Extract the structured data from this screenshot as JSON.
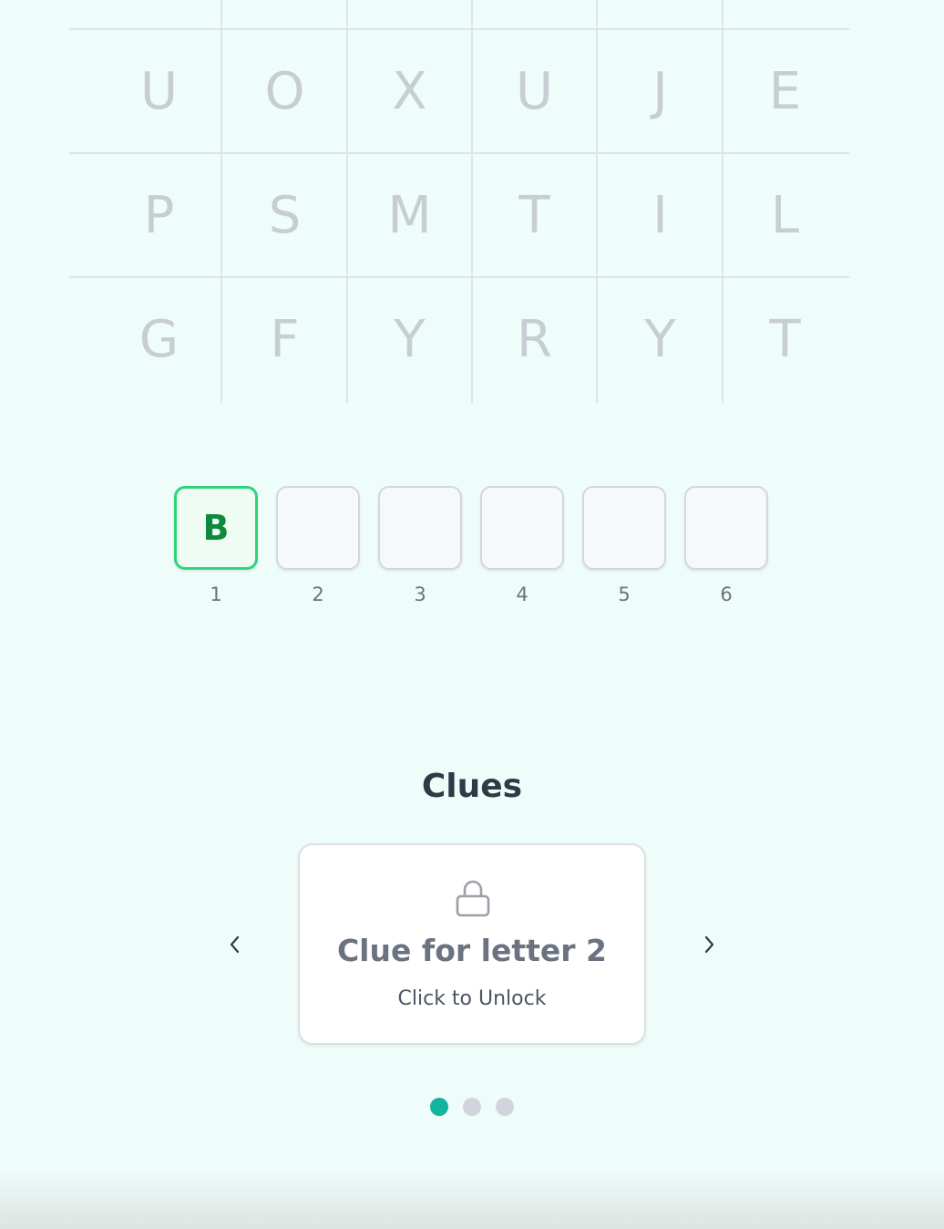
{
  "grid": {
    "rows": [
      [
        "U",
        "O",
        "X",
        "U",
        "J",
        "E"
      ],
      [
        "P",
        "S",
        "M",
        "T",
        "I",
        "L"
      ],
      [
        "G",
        "F",
        "Y",
        "R",
        "Y",
        "T"
      ]
    ]
  },
  "answer": {
    "slots": [
      {
        "letter": "B",
        "number": "1",
        "filled": true
      },
      {
        "letter": "",
        "number": "2",
        "filled": false
      },
      {
        "letter": "",
        "number": "3",
        "filled": false
      },
      {
        "letter": "",
        "number": "4",
        "filled": false
      },
      {
        "letter": "",
        "number": "5",
        "filled": false
      },
      {
        "letter": "",
        "number": "6",
        "filled": false
      }
    ]
  },
  "clues": {
    "heading": "Clues",
    "card": {
      "icon": "lock-icon",
      "title": "Clue for letter 2",
      "subtitle": "Click to Unlock"
    },
    "prev_icon": "chevron-left-icon",
    "next_icon": "chevron-right-icon",
    "pagination": {
      "total": 3,
      "active_index": 0
    }
  },
  "colors": {
    "background": "#effdfa",
    "grid_letter": "#c7cdd2",
    "filled_border": "#2ed47a",
    "filled_letter": "#0e8a3c",
    "active_dot": "#13b3a0",
    "inactive_dot": "#d1d5db"
  }
}
